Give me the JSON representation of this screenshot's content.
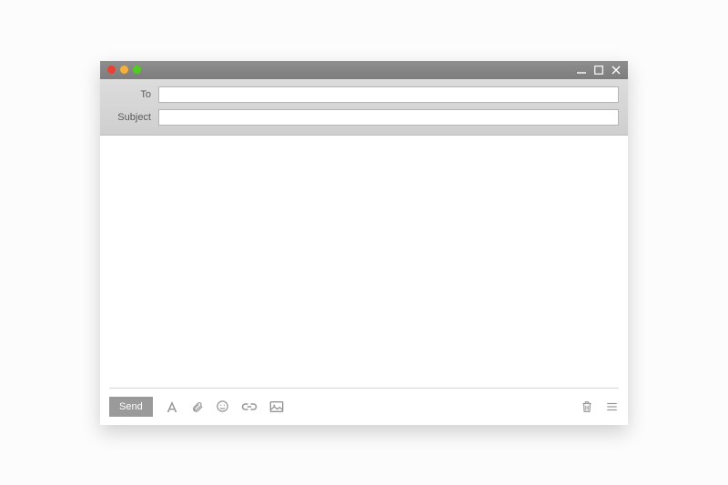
{
  "fields": {
    "to_label": "To",
    "to_value": "",
    "subject_label": "Subject",
    "subject_value": ""
  },
  "body": {
    "value": ""
  },
  "toolbar": {
    "send_label": "Send"
  }
}
